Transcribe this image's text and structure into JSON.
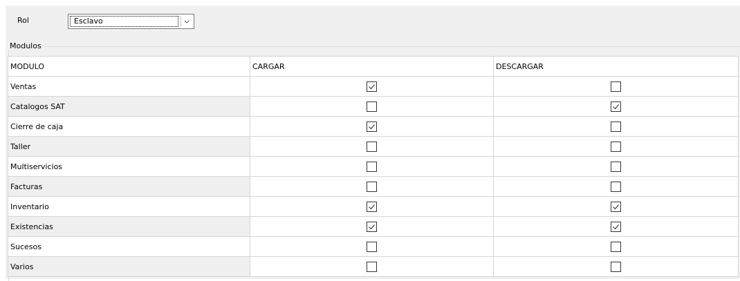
{
  "rol": {
    "label": "Rol",
    "selected": "Esclavo"
  },
  "modules_group": {
    "legend": "Modulos"
  },
  "table": {
    "headers": [
      "MODULO",
      "CARGAR",
      "DESCARGAR"
    ],
    "rows": [
      {
        "modulo": "Ventas",
        "cargar": true,
        "descargar": false
      },
      {
        "modulo": "Catalogos SAT",
        "cargar": false,
        "descargar": true
      },
      {
        "modulo": "Cierre de caja",
        "cargar": true,
        "descargar": false
      },
      {
        "modulo": "Taller",
        "cargar": false,
        "descargar": false
      },
      {
        "modulo": "Multiservicios",
        "cargar": false,
        "descargar": false
      },
      {
        "modulo": "Facturas",
        "cargar": false,
        "descargar": false
      },
      {
        "modulo": "Inventario",
        "cargar": true,
        "descargar": true
      },
      {
        "modulo": "Existencias",
        "cargar": true,
        "descargar": true
      },
      {
        "modulo": "Sucesos",
        "cargar": false,
        "descargar": false
      },
      {
        "modulo": "Varios",
        "cargar": false,
        "descargar": false
      }
    ]
  }
}
